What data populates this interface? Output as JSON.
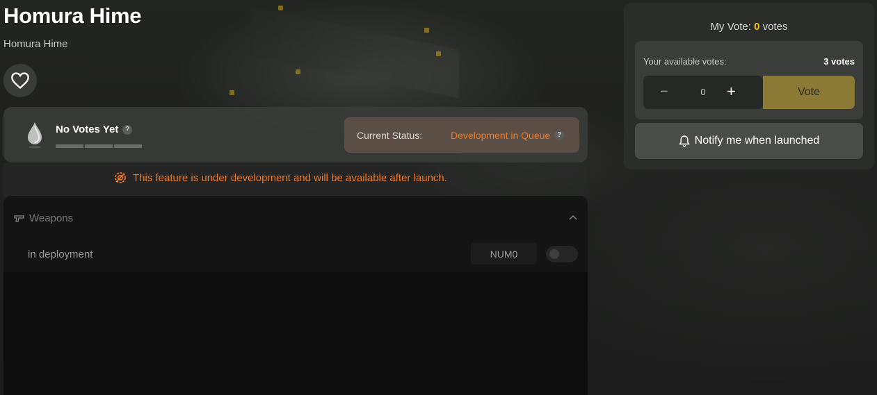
{
  "header": {
    "title": "Homura Hime",
    "subtitle": "Homura Hime"
  },
  "status_card": {
    "votes_label": "No Votes Yet",
    "help_glyph": "?",
    "status_label": "Current Status:",
    "status_value": "Development in Queue",
    "status_color": "#f07a26"
  },
  "notice": {
    "text": "This feature is under development and will be available after launch.",
    "color": "#f07a26",
    "icon": "gear-warning-icon"
  },
  "panel": {
    "section_title": "Weapons",
    "section_icon": "pistol-icon",
    "row_label": "in deployment",
    "num_badge": "NUM0",
    "toggle_on": false
  },
  "vote": {
    "my_vote_prefix": "My Vote: ",
    "my_vote_count": "0",
    "my_vote_suffix": " votes",
    "available_label": "Your available votes:",
    "available_count": "3 votes",
    "minus": "−",
    "quantity": "0",
    "plus": "+",
    "vote_button": "Vote",
    "notify_button": "Notify me when launched",
    "accent_color": "#f2c21b"
  }
}
